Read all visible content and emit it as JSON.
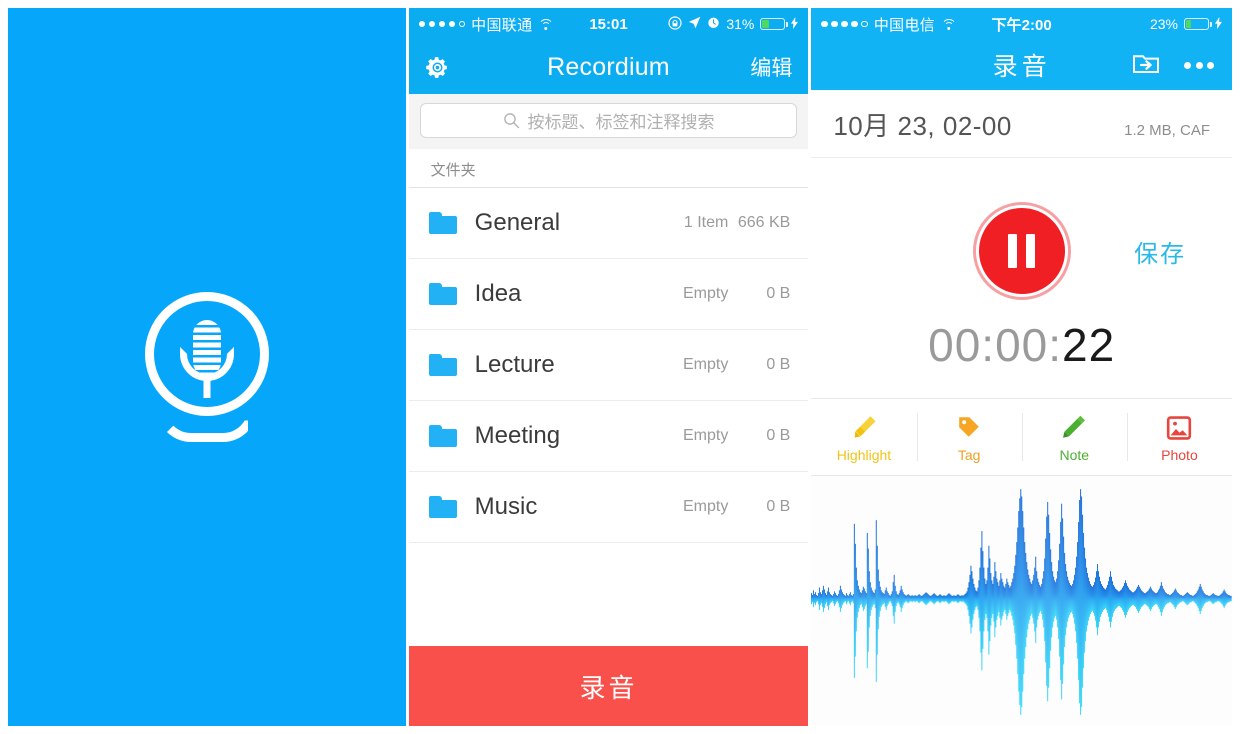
{
  "left_panel": {
    "name": "splash-screen",
    "background_color": "#06a7fb",
    "logo_icon": "microphone-icon"
  },
  "middle_panel": {
    "status_bar": {
      "signal_dots": 5,
      "signal_filled": 4,
      "carrier": "中国联通",
      "wifi_icon": "wifi-icon",
      "time": "15:01",
      "indicators": [
        "rotation-lock-icon",
        "location-arrow-icon",
        "alarm-clock-icon"
      ],
      "battery_percent": "31%",
      "battery_level": 31,
      "charging_icon": "bolt-icon",
      "background_color": "#0badf0"
    },
    "navbar": {
      "settings_icon": "gear-icon",
      "title": "Recordium",
      "edit_label": "编辑"
    },
    "search": {
      "icon": "search-icon",
      "placeholder": "按标题、标签和注释搜索",
      "value": ""
    },
    "section_header": "文件夹",
    "folder_columns": [
      "name",
      "count",
      "size"
    ],
    "folders": [
      {
        "icon": "folder-icon",
        "name": "General",
        "count": "1 Item",
        "size": "666 KB"
      },
      {
        "icon": "folder-icon",
        "name": "Idea",
        "count": "Empty",
        "size": "0 B"
      },
      {
        "icon": "folder-icon",
        "name": "Lecture",
        "count": "Empty",
        "size": "0 B"
      },
      {
        "icon": "folder-icon",
        "name": "Meeting",
        "count": "Empty",
        "size": "0 B"
      },
      {
        "icon": "folder-icon",
        "name": "Music",
        "count": "Empty",
        "size": "0 B"
      }
    ],
    "record_button": {
      "label": "录音",
      "color": "#f9504b"
    }
  },
  "right_panel": {
    "status_bar": {
      "signal_dots": 5,
      "signal_filled": 4,
      "carrier": "中国电信",
      "wifi_icon": "wifi-icon",
      "time": "下午2:00",
      "battery_percent": "23%",
      "battery_level": 23,
      "charging_icon": "bolt-icon",
      "background_color": "#12b3f4"
    },
    "navbar": {
      "title": "录音",
      "move_to_folder_icon": "folder-move-icon",
      "more_icon": "more-dots-icon"
    },
    "recording": {
      "title": "10月 23, 02-00",
      "size": "1.2 MB, CAF",
      "pause_icon": "pause-icon",
      "pause_color": "#ef1f24",
      "save_label": "保存",
      "save_color": "#2ab8e8",
      "timer": "00:00:22",
      "timer_dim": "00:00:",
      "timer_lit": "22"
    },
    "tools": [
      {
        "icon": "highlighter-icon",
        "label": "Highlight",
        "color": "#f5c518"
      },
      {
        "icon": "tag-icon",
        "label": "Tag",
        "color": "#f5a623"
      },
      {
        "icon": "pencil-icon",
        "label": "Note",
        "color": "#4caf2f"
      },
      {
        "icon": "photo-icon",
        "label": "Photo",
        "color": "#e8453c"
      }
    ],
    "waveform": {
      "name": "audio-waveform",
      "color_top": "#0a6fd8",
      "color_bottom": "#22d3f5"
    }
  }
}
